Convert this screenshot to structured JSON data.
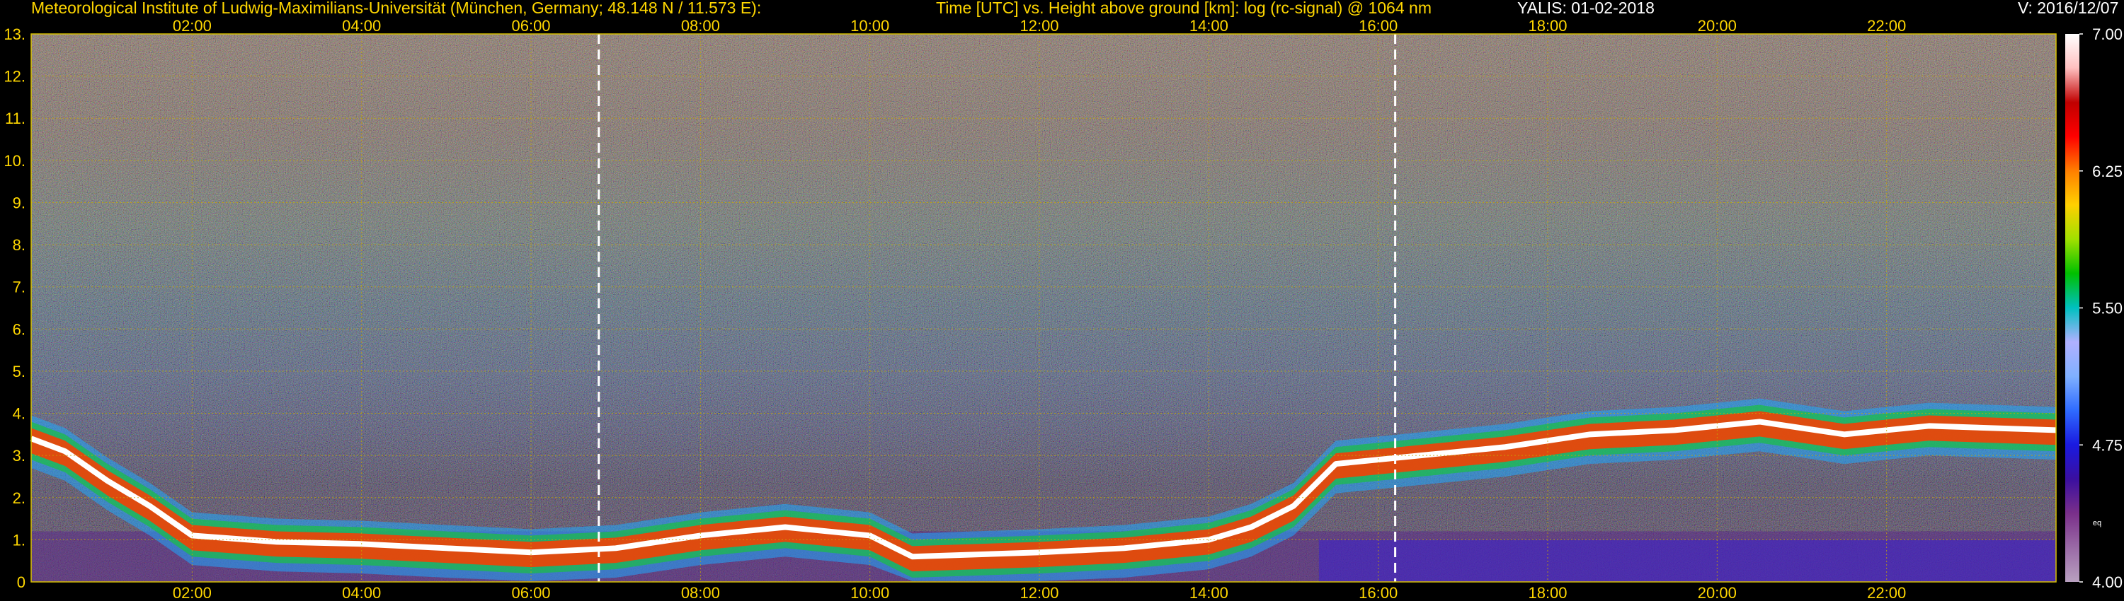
{
  "header": {
    "institute": "Meteorological Institute of Ludwig-Maximilians-Universität (München, Germany; 48.148 N / 11.573 E):",
    "description": "Time [UTC] vs. Height above ground [km]: log (rc-signal) @ 1064 nm",
    "instrument": "YALIS: 01-02-2018",
    "version": "V: 2016/12/07"
  },
  "colorbar": {
    "tick_labels": [
      "7.00",
      "6.25",
      "5.50",
      "4.75",
      "4.00"
    ],
    "note": "eq",
    "colors": [
      "#b8a0c0",
      "#9a6aa6",
      "#7a2f8a",
      "#3a0fa0",
      "#1a1ae0",
      "#2f6bff",
      "#7fb0ff",
      "#b0b0ff",
      "#00c0c0",
      "#00c000",
      "#a0e000",
      "#ffd000",
      "#ff7f00",
      "#ff0000",
      "#c00000",
      "#ffc0c0",
      "#ffffff"
    ]
  },
  "chart_data": {
    "type": "heatmap",
    "title": "Time [UTC] vs. Height above ground [km]: log (rc-signal) @ 1064 nm",
    "x_ticks": [
      "02:00",
      "04:00",
      "06:00",
      "08:00",
      "10:00",
      "12:00",
      "14:00",
      "16:00",
      "18:00",
      "20:00",
      "22:00"
    ],
    "y_ticks": [
      "0",
      "1.",
      "2.",
      "3.",
      "4.",
      "5.",
      "6.",
      "7.",
      "8.",
      "9.",
      "10.",
      "11.",
      "12.",
      "13."
    ],
    "xlim_hours": [
      0.1,
      24
    ],
    "ylim_km": [
      0,
      13
    ],
    "clim": [
      4.0,
      7.0
    ],
    "marker_lines_hours": [
      6.8,
      16.2
    ],
    "boundary_layer_top_km": [
      [
        0.1,
        3.4
      ],
      [
        0.5,
        3.1
      ],
      [
        1.0,
        2.4
      ],
      [
        1.5,
        1.8
      ],
      [
        2.0,
        1.1
      ],
      [
        3.0,
        0.95
      ],
      [
        4.0,
        0.9
      ],
      [
        5.0,
        0.8
      ],
      [
        6.0,
        0.7
      ],
      [
        7.0,
        0.8
      ],
      [
        8.0,
        1.1
      ],
      [
        9.0,
        1.3
      ],
      [
        10.0,
        1.1
      ],
      [
        10.5,
        0.6
      ],
      [
        12.0,
        0.7
      ],
      [
        13.0,
        0.8
      ],
      [
        14.0,
        1.0
      ],
      [
        14.5,
        1.3
      ],
      [
        15.0,
        1.8
      ],
      [
        15.5,
        2.8
      ],
      [
        16.5,
        3.0
      ],
      [
        17.5,
        3.2
      ],
      [
        18.5,
        3.5
      ],
      [
        19.5,
        3.6
      ],
      [
        20.5,
        3.8
      ],
      [
        21.5,
        3.5
      ],
      [
        22.5,
        3.7
      ],
      [
        24.0,
        3.6
      ]
    ],
    "grid": true
  }
}
